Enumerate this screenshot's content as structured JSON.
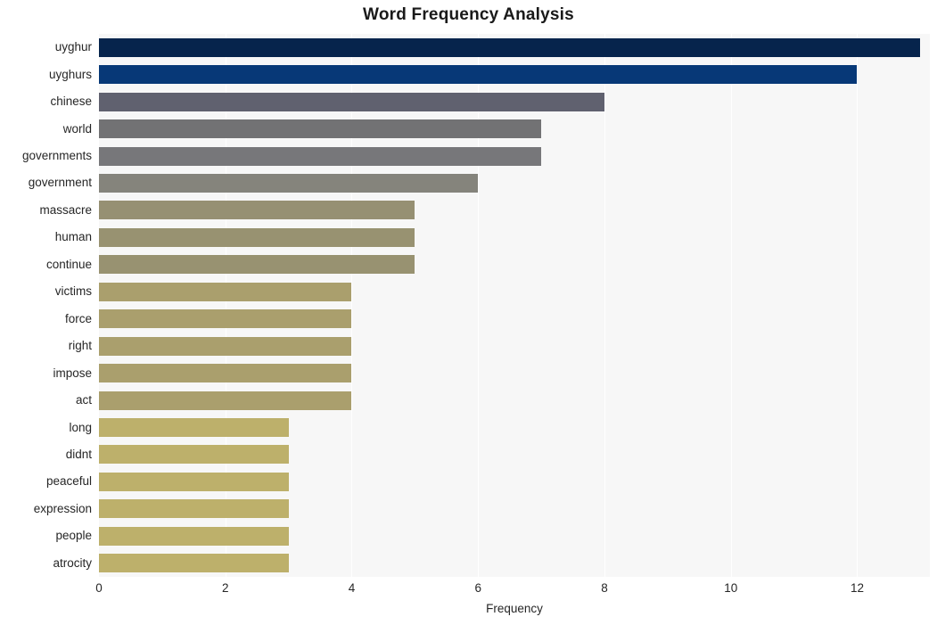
{
  "chart_data": {
    "type": "bar",
    "orientation": "horizontal",
    "title": "Word Frequency Analysis",
    "xlabel": "Frequency",
    "ylabel": "",
    "categories": [
      "uyghur",
      "uyghurs",
      "chinese",
      "world",
      "governments",
      "government",
      "massacre",
      "human",
      "continue",
      "victims",
      "force",
      "right",
      "impose",
      "act",
      "long",
      "didnt",
      "peaceful",
      "expression",
      "people",
      "atrocity"
    ],
    "values": [
      13,
      12,
      8,
      7,
      7,
      6,
      5,
      5,
      5,
      4,
      4,
      4,
      4,
      4,
      3,
      3,
      3,
      3,
      3,
      3
    ],
    "bar_colors": [
      "#06244c",
      "#073877",
      "#60616f",
      "#727274",
      "#77777a",
      "#85847c",
      "#969073",
      "#989271",
      "#989271",
      "#aa9f6d",
      "#aa9f6d",
      "#aa9f6d",
      "#aa9f6d",
      "#aa9f6d",
      "#bdb06b",
      "#bdb06b",
      "#bdb06b",
      "#bdb06b",
      "#bdb06b",
      "#bdb06b"
    ],
    "xticks": [
      0,
      2,
      4,
      6,
      8,
      10,
      12
    ],
    "xlim": [
      0,
      13.15
    ],
    "grid": true,
    "grid_axis": "x",
    "grid_color": "#ffffff",
    "plot_background": "#f7f7f7",
    "figure_background": "#ffffff",
    "legend": null
  }
}
